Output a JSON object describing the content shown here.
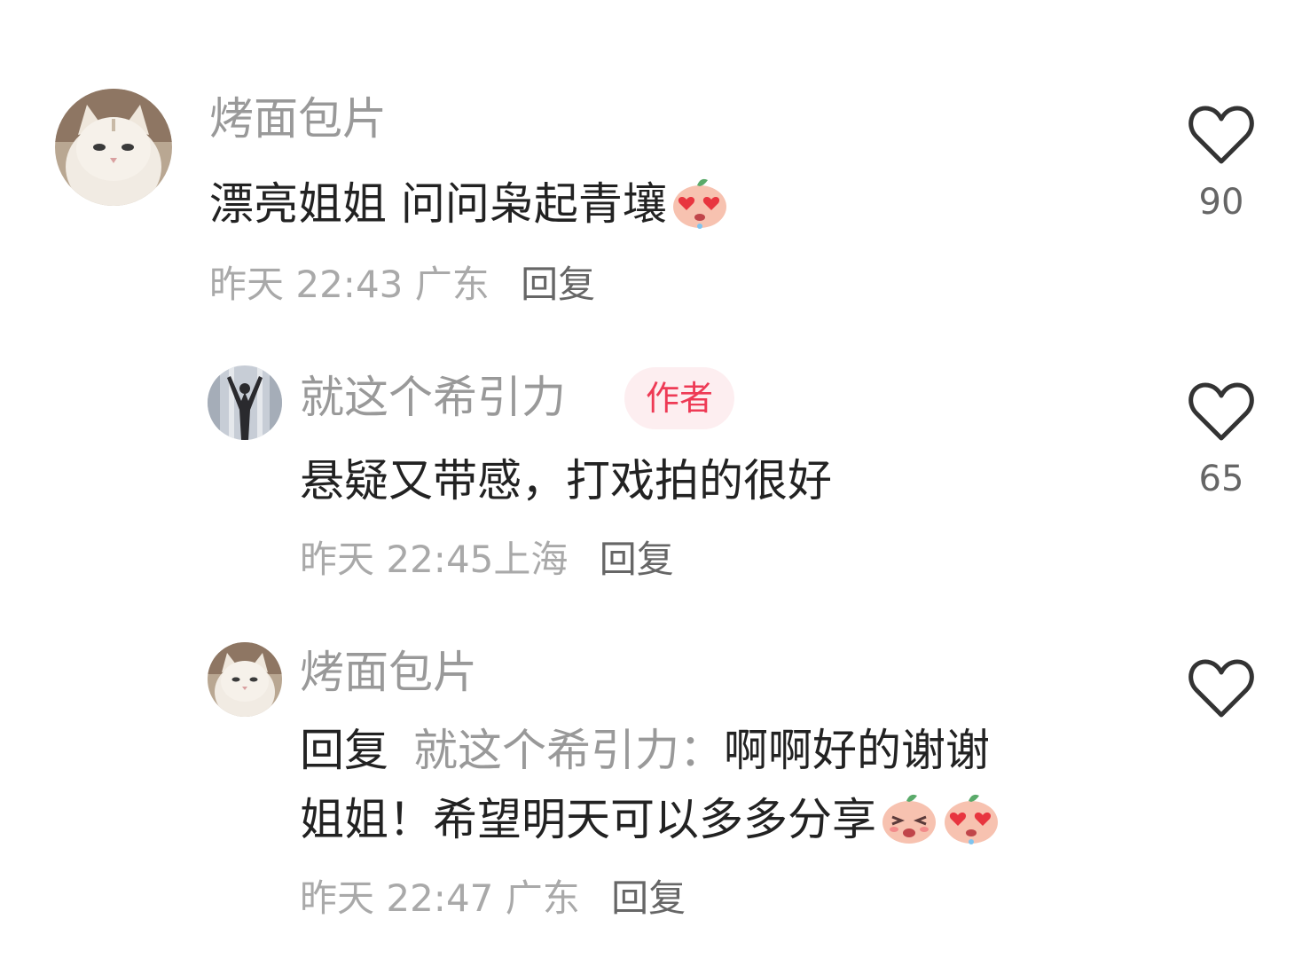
{
  "comments": [
    {
      "username": "烤面包片",
      "text": "漂亮姐姐 问问枭起青壤",
      "emojis": [
        "heart-eyes-peach-emoji"
      ],
      "time": "昨天 22:43",
      "location": "广东",
      "reply_label": "回复",
      "likes": "90",
      "avatar": "white-cat-avatar"
    },
    {
      "username": "就这个希引力",
      "badge": "作者",
      "text": "悬疑又带感，打戏拍的很好",
      "time": "昨天 22:45",
      "location": "上海",
      "reply_label": "回复",
      "likes": "65",
      "avatar": "silhouette-avatar"
    },
    {
      "username": "烤面包片",
      "reply_prefix": "回复",
      "reply_target": "就这个希引力：",
      "text_line1": "啊啊好的谢谢",
      "text_line2": "姐姐！希望明天可以多多分享",
      "emojis": [
        "blushing-peach-emoji",
        "heart-eyes-peach-emoji"
      ],
      "time": "昨天 22:47",
      "location": "广东",
      "reply_label": "回复",
      "likes": "",
      "avatar": "white-cat-avatar"
    }
  ],
  "colors": {
    "username": "#999999",
    "body": "#222222",
    "meta": "#a9a9a9",
    "badge_bg": "#fdeef0",
    "badge_text": "#ee3a55"
  }
}
